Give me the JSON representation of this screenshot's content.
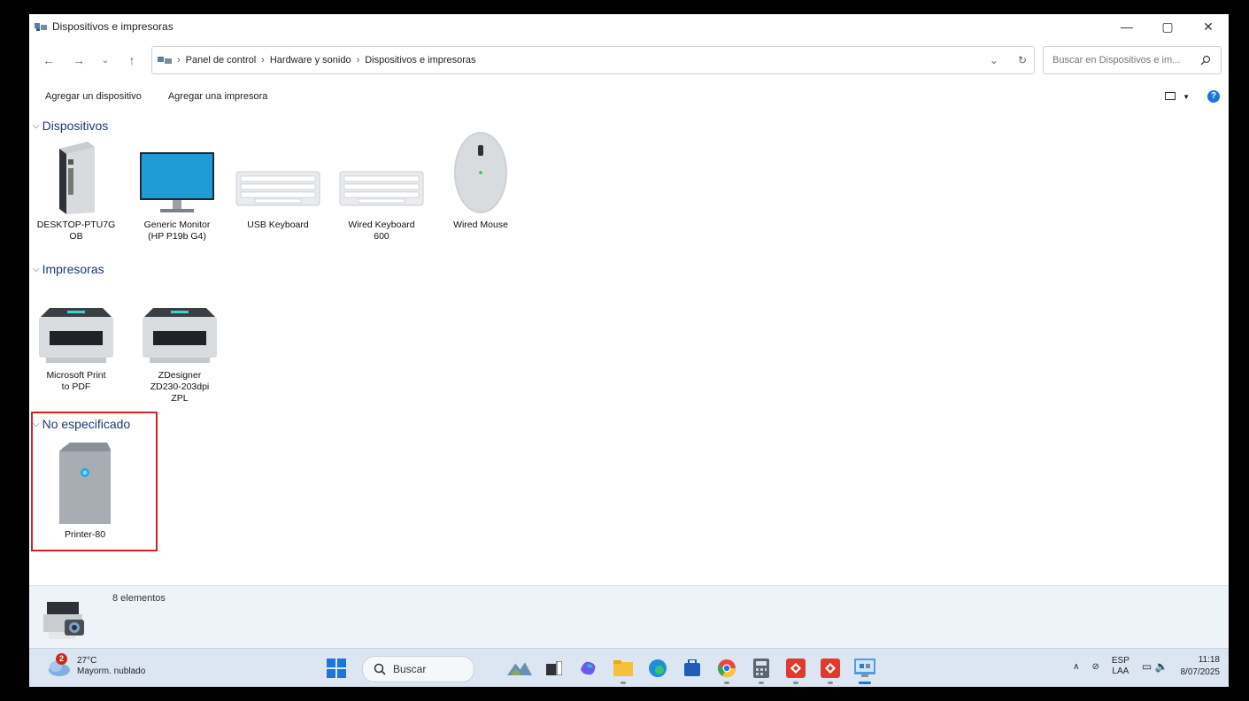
{
  "window": {
    "title": "Dispositivos e impresoras",
    "controls": {
      "minimize": "—",
      "maximize": "▢",
      "close": "✕"
    }
  },
  "address": {
    "breadcrumbs": [
      "Panel de control",
      "Hardware y sonido",
      "Dispositivos e impresoras"
    ],
    "search_placeholder": "Buscar en Dispositivos e im..."
  },
  "toolbar": {
    "add_device": "Agregar un dispositivo",
    "add_printer": "Agregar una impresora"
  },
  "sections": {
    "devices": {
      "header": "Dispositivos",
      "items": [
        {
          "line1": "DESKTOP-PTU7G",
          "line2": "OB",
          "icon": "computer-tower-icon"
        },
        {
          "line1": "Generic Monitor",
          "line2": "(HP P19b G4)",
          "icon": "monitor-icon"
        },
        {
          "line1": "USB Keyboard",
          "line2": "",
          "icon": "keyboard-icon"
        },
        {
          "line1": "Wired Keyboard",
          "line2": "600",
          "icon": "keyboard-icon"
        },
        {
          "line1": "Wired Mouse",
          "line2": "",
          "icon": "mouse-icon"
        }
      ]
    },
    "printers": {
      "header": "Impresoras",
      "items": [
        {
          "line1": "Microsoft Print",
          "line2": "to PDF",
          "line3": "",
          "icon": "printer-icon"
        },
        {
          "line1": "ZDesigner",
          "line2": "ZD230-203dpi",
          "line3": "ZPL",
          "icon": "printer-icon"
        }
      ]
    },
    "unspecified": {
      "header": "No especificado",
      "items": [
        {
          "line1": "Printer-80",
          "icon": "generic-device-icon"
        }
      ]
    }
  },
  "details": {
    "count": "8 elementos"
  },
  "taskbar": {
    "weather": {
      "badge": "2",
      "temp": "27°C",
      "desc": "Mayorm. nublado"
    },
    "search_label": "Buscar",
    "tray": {
      "lang1": "ESP",
      "lang2": "LAA",
      "time": "11:18",
      "date": "8/07/2025"
    }
  },
  "colors": {
    "accent": "#1e74d8",
    "highlight": "#d61f1f",
    "section_header": "#1a3a6b"
  }
}
